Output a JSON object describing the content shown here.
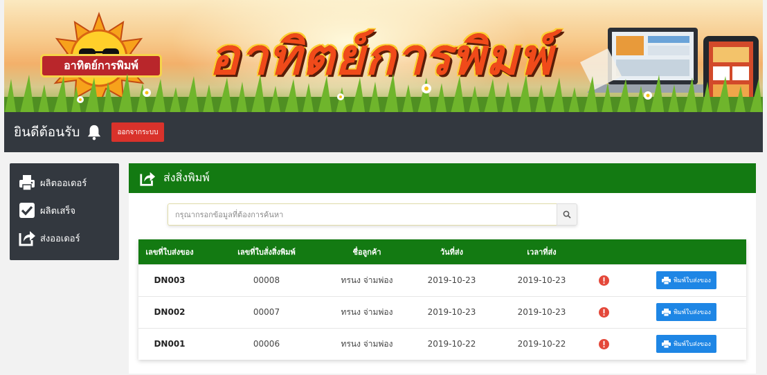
{
  "brand": {
    "logo_text": "อาทิตย์การพิมพ์",
    "title": "อาทิตย์การพิมพ์"
  },
  "topbar": {
    "welcome": "ยินดีต้อนรับ",
    "bell_icon": "bell-icon",
    "logout_label": "ออกจากระบบ"
  },
  "sidebar": {
    "items": [
      {
        "label": "ผลิตออเดอร์",
        "icon": "printer-icon"
      },
      {
        "label": "ผลิตเสร็จ",
        "icon": "checkbox-icon"
      },
      {
        "label": "ส่งออเดอร์",
        "icon": "share-icon"
      }
    ]
  },
  "panel": {
    "title": "ส่งสิ่งพิมพ์",
    "icon": "share-icon"
  },
  "search": {
    "placeholder": "กรุณากรอกข้อมูลที่ต้องการค้นหา",
    "icon": "search-icon"
  },
  "table": {
    "headers": [
      "เลขที่ใบส่งของ",
      "เลขที่ใบสั่งสิ่งพิมพ์",
      "ชื่อลูกค้า",
      "วันที่ส่ง",
      "เวลาที่ส่ง"
    ],
    "print_label": "พิมพ์ใบส่งของ",
    "rows": [
      {
        "delivery_no": "DN003",
        "order_no": "00008",
        "customer": "ทรนง จ่ามพ่อง",
        "date": "2019-10-23",
        "time": "2019-10-23"
      },
      {
        "delivery_no": "DN002",
        "order_no": "00007",
        "customer": "ทรนง จ่ามพ่อง",
        "date": "2019-10-23",
        "time": "2019-10-23"
      },
      {
        "delivery_no": "DN001",
        "order_no": "00006",
        "customer": "ทรนง จ่ามพ่อง",
        "date": "2019-10-22",
        "time": "2019-10-22"
      }
    ]
  },
  "colors": {
    "header_green": "#137a12",
    "dark_bar": "#33383f",
    "logout_red": "#d9322b",
    "print_blue": "#1e86e5",
    "info_red": "#e4483a"
  }
}
